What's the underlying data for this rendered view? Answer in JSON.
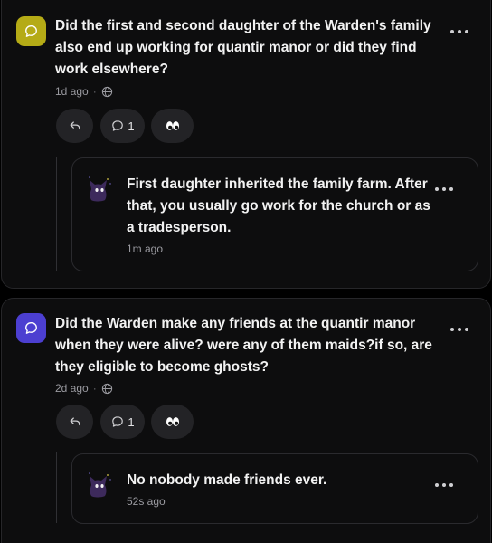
{
  "posts": [
    {
      "question": "Did the first and second daughter of the Warden's family also end up working for quantir manor or did they find work elsewhere?",
      "time": "1d ago",
      "comment_count": "1",
      "avatar_color": "#b5ab16",
      "reply": {
        "text": "First daughter inherited the family farm. After that, you usually go work for the church or as a tradesperson.",
        "time": "1m ago"
      }
    },
    {
      "question": "Did the Warden make any friends at the quantir manor when they were alive? were any of them maids?if so, are they eligible to become ghosts?",
      "time": "2d ago",
      "comment_count": "1",
      "avatar_color": "#4c3fd1",
      "reply": {
        "text": "No nobody made friends ever.",
        "time": "52s ago"
      }
    }
  ],
  "icons": {
    "question_avatar": "speech-bubble-icon",
    "visibility": "globe-icon",
    "reply": "reply-arrow-icon",
    "comments": "comment-bubble-icon",
    "reaction": "eyes-icon",
    "more": "more-dots-icon",
    "reply_avatar": "purple-ghost-cat-avatar"
  }
}
